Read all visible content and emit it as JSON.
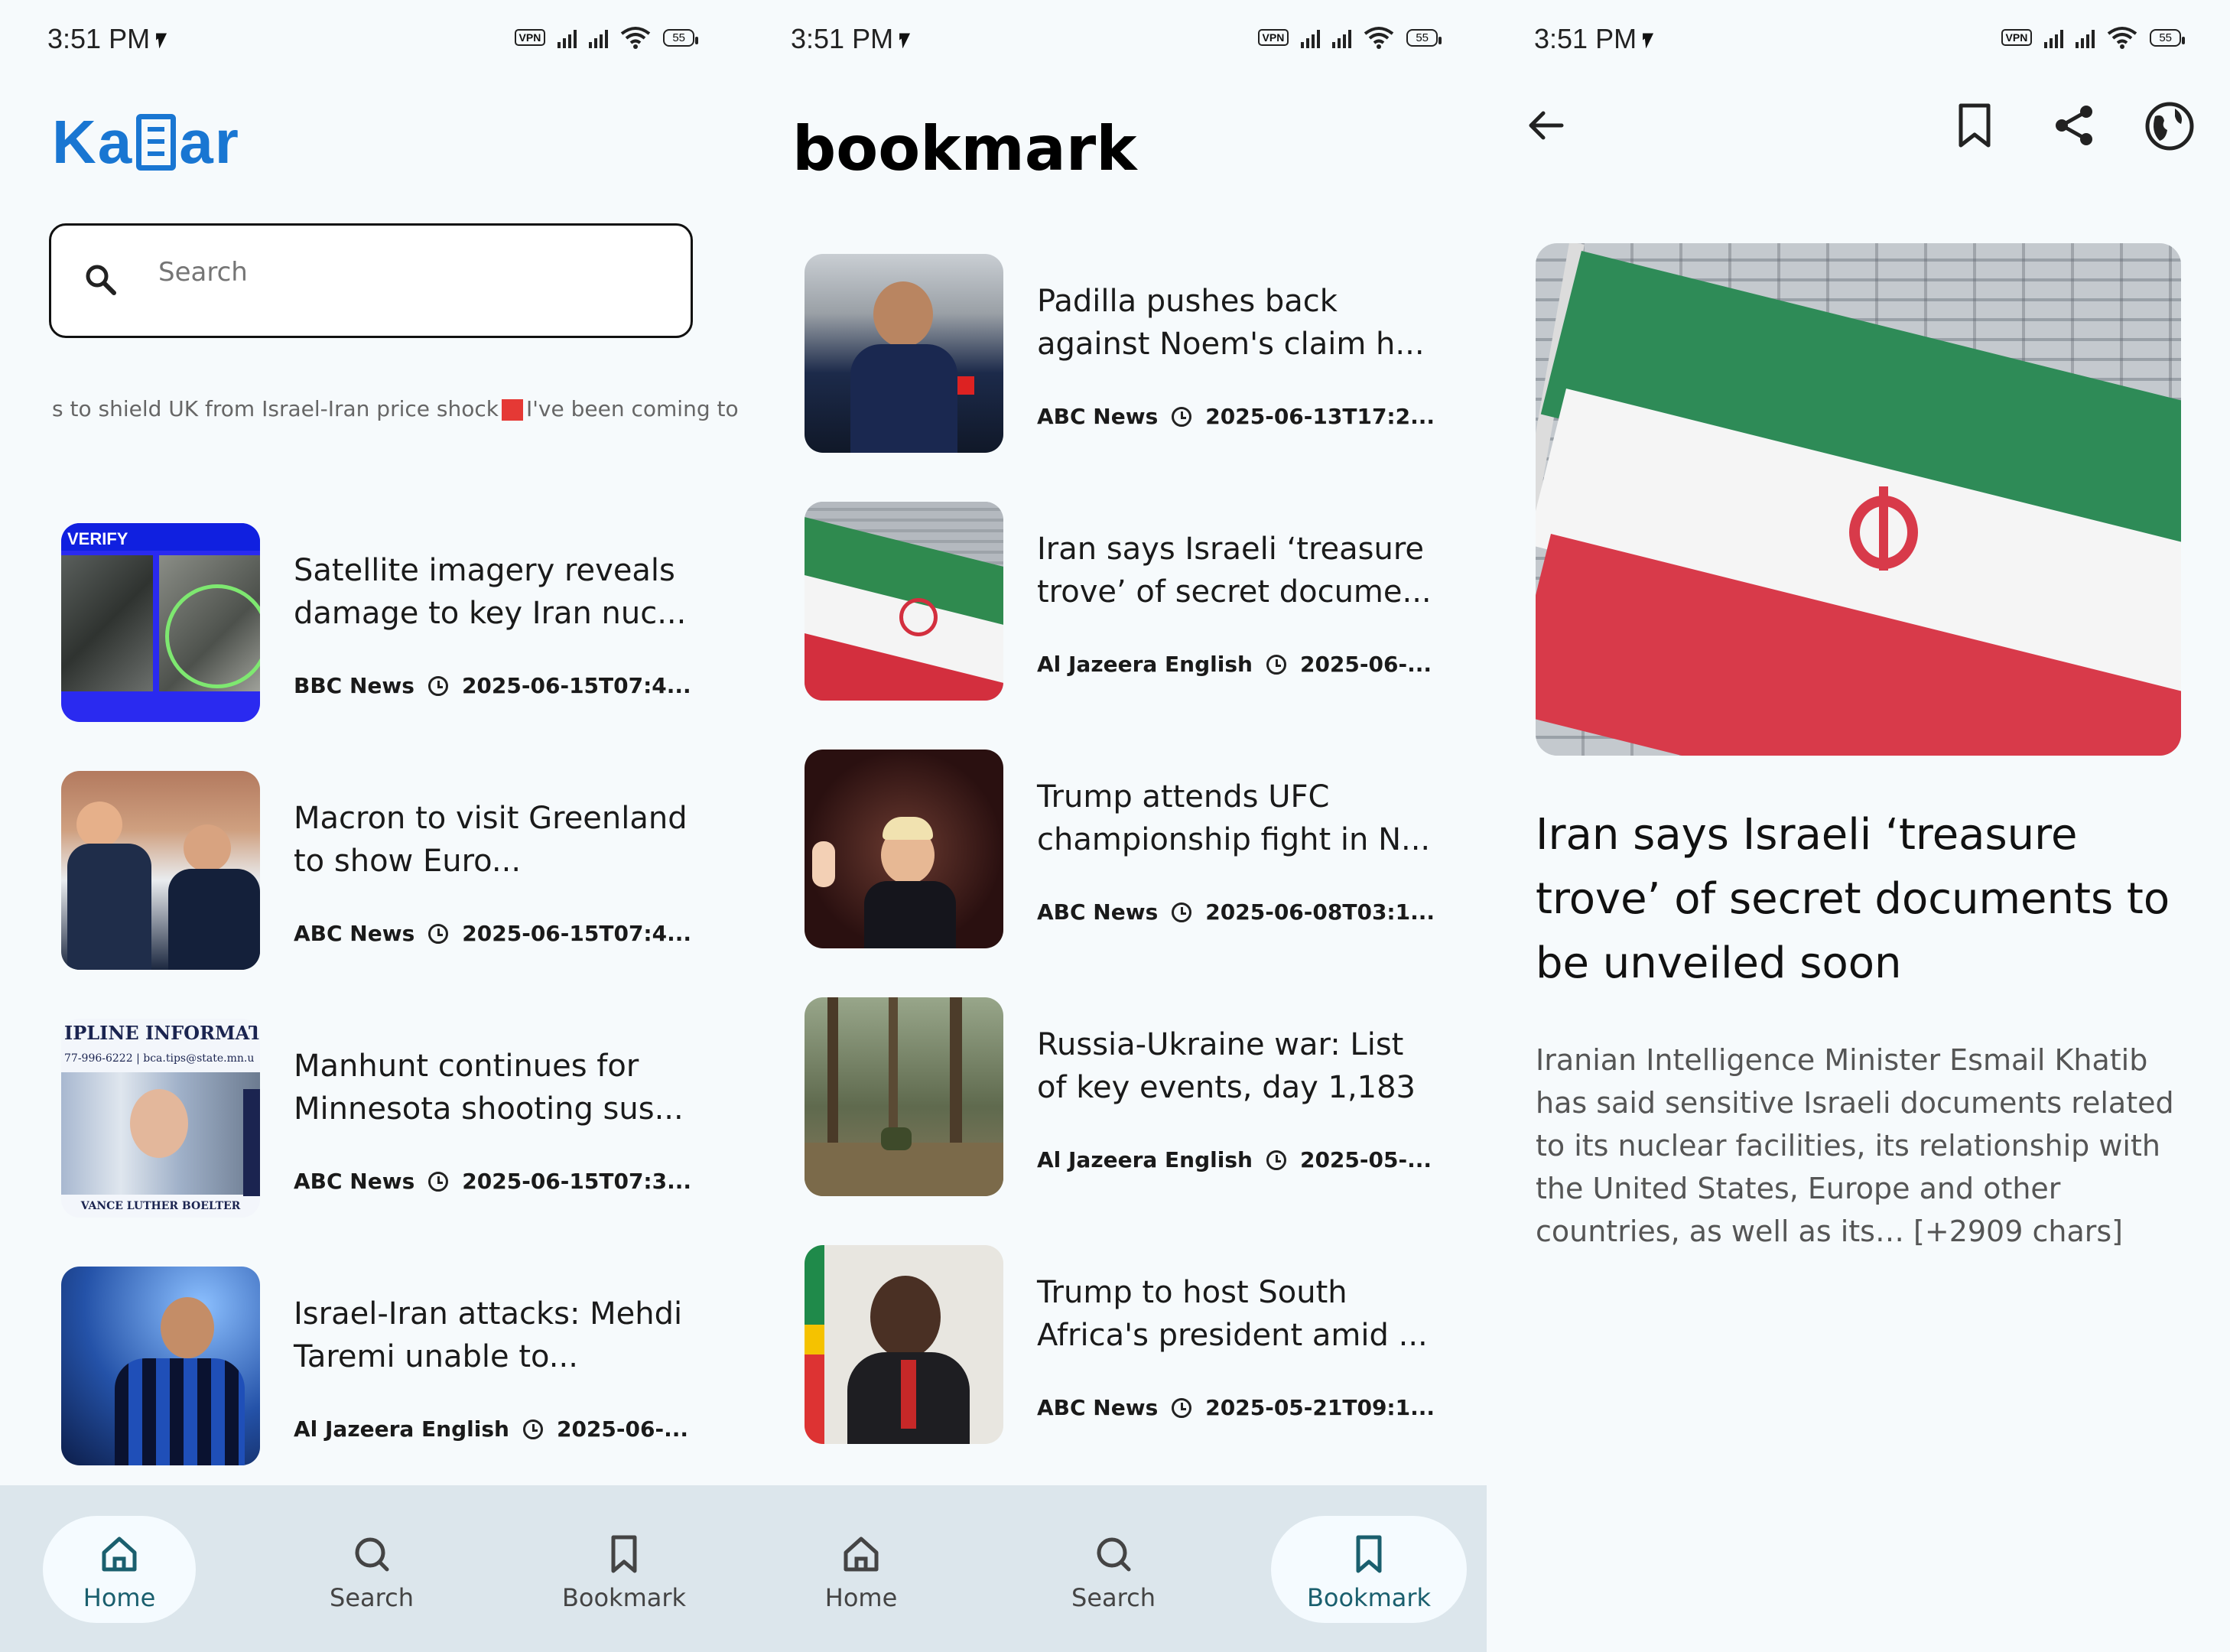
{
  "status_bar": {
    "time": "3:51 PM",
    "vpn": "VPN",
    "battery": "55"
  },
  "home": {
    "logo_left": "Ka",
    "logo_right": "ar",
    "search_placeholder": "Search",
    "ticker_left": "s to shield UK from Israel-Iran price shock",
    "ticker_right": "I've been coming to Dowr",
    "articles": [
      {
        "title": "Satellite imagery reveals damage to key Iran nuc...",
        "source": "BBC News",
        "date": "2025-06-15T07:4...",
        "thumb_label": "VERIFY"
      },
      {
        "title": "Macron to visit Greenland to show Euro...",
        "source": "ABC News",
        "date": "2025-06-15T07:4..."
      },
      {
        "title": "Manhunt continues for Minnesota shooting sus...",
        "source": "ABC News",
        "date": "2025-06-15T07:3...",
        "thumb_label": "IPLINE INFORMATIO",
        "thumb_sub": "77-996-6222 | bca.tips@state.mn.u",
        "thumb_name": "VANCE LUTHER BOELTER"
      },
      {
        "title": "Israel-Iran attacks: Mehdi Taremi unable to...",
        "source": "Al Jazeera English",
        "date": "2025-06-..."
      }
    ]
  },
  "bookmark": {
    "title": "bookmark",
    "articles": [
      {
        "title": "Padilla pushes back against Noem's claim h...",
        "source": "ABC News",
        "date": "2025-06-13T17:2..."
      },
      {
        "title": "Iran says Israeli ‘treasure trove’ of secret docume...",
        "source": "Al Jazeera English",
        "date": "2025-06-..."
      },
      {
        "title": "Trump attends UFC championship fight in N...",
        "source": "ABC News",
        "date": "2025-06-08T03:1..."
      },
      {
        "title": "Russia-Ukraine war: List of key events, day 1,183",
        "source": "Al Jazeera English",
        "date": "2025-05-..."
      },
      {
        "title": "Trump to host South Africa's president amid ...",
        "source": "ABC News",
        "date": "2025-05-21T09:1..."
      }
    ]
  },
  "nav": {
    "home": "Home",
    "search": "Search",
    "bookmark": "Bookmark"
  },
  "detail": {
    "title": "Iran says Israeli ‘treasure trove’ of secret documents to be unveiled soon",
    "description": "Iranian Intelligence Minister Esmail Khatib has said sensitive Israeli documents related to its nuclear facilities, its relationship with the United States, Europe and other countries, as well as its… [+2909 chars]"
  },
  "colors": {
    "brand": "#1976d2",
    "nav_bg": "#dce6ec",
    "nav_active": "#1a5f6e",
    "ticker_marker": "#e53935"
  },
  "icons": [
    "search-icon",
    "home-icon",
    "bookmark-icon",
    "back-arrow-icon",
    "share-icon",
    "globe-icon",
    "clock-icon",
    "wifi-icon",
    "signal-icon",
    "battery-icon"
  ]
}
